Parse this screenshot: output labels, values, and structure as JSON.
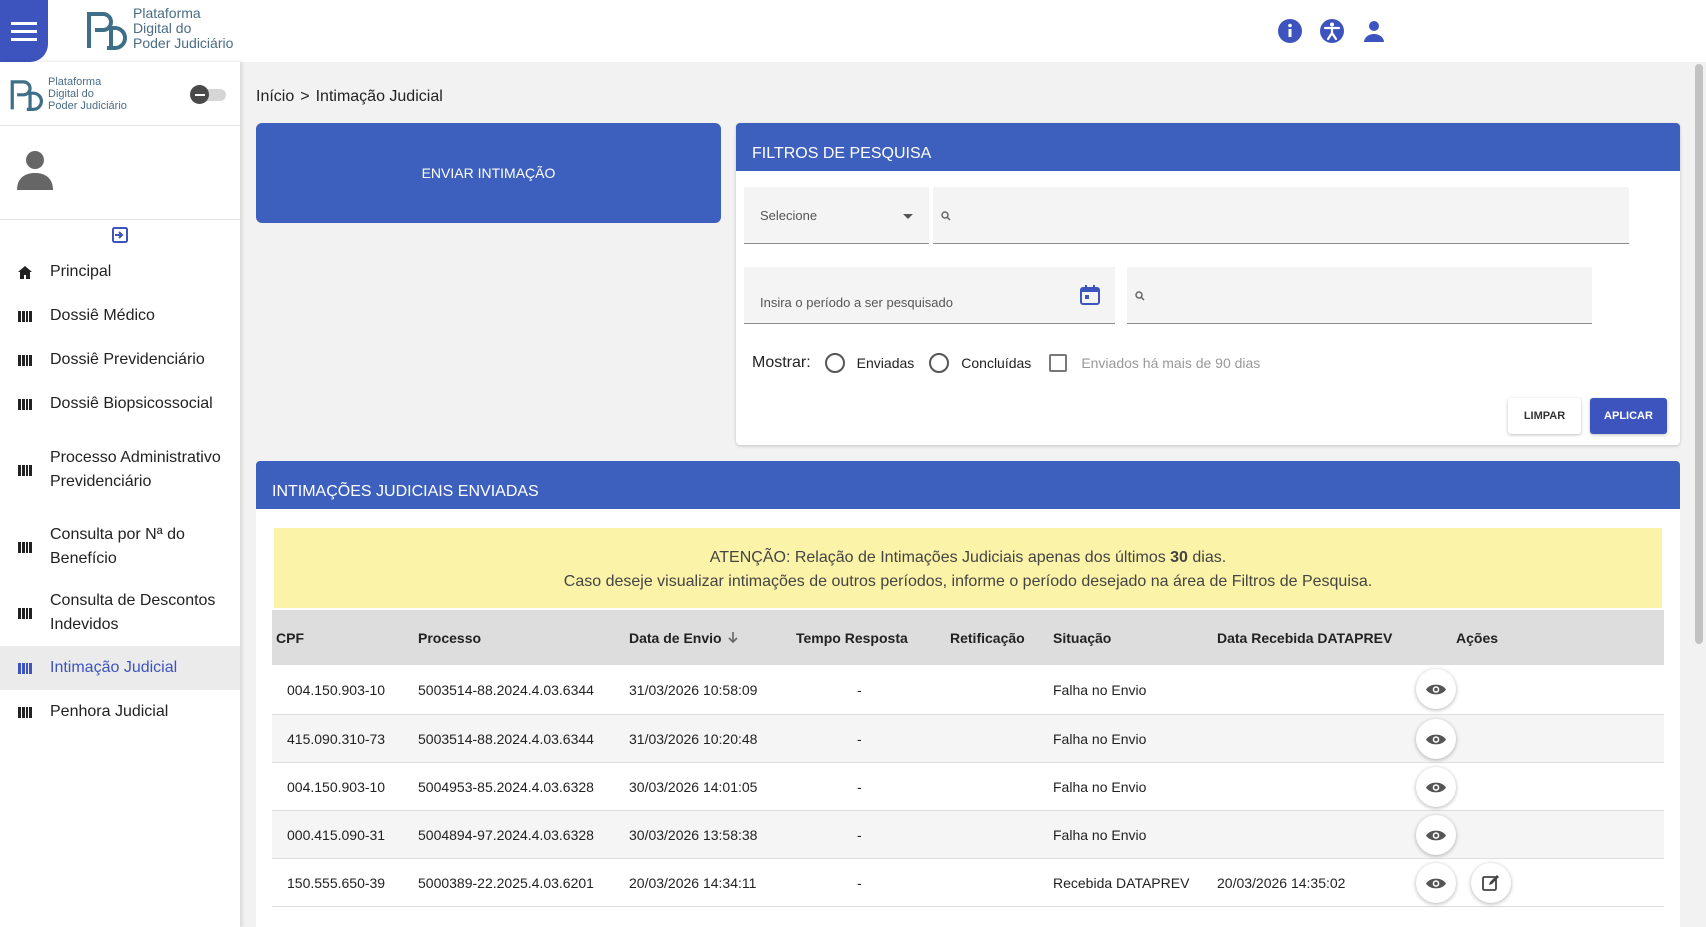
{
  "topbar": {
    "logo_lines": [
      "Plataforma",
      "Digital do",
      "Poder Judiciário"
    ],
    "icons": [
      "info-icon",
      "accessibility-icon",
      "user-icon"
    ]
  },
  "sidebar": {
    "logo_lines": [
      "Plataforma",
      "Digital do",
      "Poder Judiciário"
    ],
    "items": [
      {
        "label": "Principal",
        "icon": "home-icon"
      },
      {
        "label": "Dossiê Médico",
        "icon": "library-icon"
      },
      {
        "label": "Dossiê Previdenciário",
        "icon": "library-icon"
      },
      {
        "label": "Dossiê Biopsicossocial",
        "icon": "library-icon"
      },
      {
        "label": "Processo Administrativo Previdenciário",
        "icon": "library-icon"
      },
      {
        "label": "Consulta por Nª do Benefício",
        "icon": "library-icon"
      },
      {
        "label": "Consulta de Descontos Indevidos",
        "icon": "library-icon"
      },
      {
        "label": "Intimação Judicial",
        "icon": "library-icon",
        "active": true
      },
      {
        "label": "Penhora Judicial",
        "icon": "library-icon"
      }
    ]
  },
  "breadcrumb": {
    "home": "Início",
    "separator": ">",
    "current": "Intimação Judicial"
  },
  "send_button": "ENVIAR INTIMAÇÃO",
  "filters": {
    "title": "FILTROS DE PESQUISA",
    "select_placeholder": "Selecione",
    "period_placeholder": "Insira o período a ser pesquisado",
    "show_label": "Mostrar:",
    "opt_sent": "Enviadas",
    "opt_done": "Concluídas",
    "opt_old": "Enviados há mais de 90 dias",
    "clear": "LIMPAR",
    "apply": "APLICAR"
  },
  "results": {
    "title": "INTIMAÇÕES JUDICIAIS ENVIADAS",
    "warning_pre": "ATENÇÃO: Relação de Intimações Judiciais apenas dos últimos ",
    "warning_days": "30",
    "warning_post": " dias.",
    "warning_line2": "Caso deseje visualizar intimações de outros períodos, informe o período desejado na área de Filtros de Pesquisa.",
    "columns": [
      "CPF",
      "Processo",
      "Data de Envio",
      "Tempo Resposta",
      "Retificação",
      "Situação",
      "Data Recebida DATAPREV",
      "Ações"
    ],
    "rows": [
      {
        "cpf": "004.150.903-10",
        "processo": "5003514-88.2024.4.03.6344",
        "data_envio": "31/03/2026 10:58:09",
        "tempo": "-",
        "retificacao": "",
        "situacao": "Falha no Envio",
        "data_dataprev": "",
        "edit": false
      },
      {
        "cpf": "415.090.310-73",
        "processo": "5003514-88.2024.4.03.6344",
        "data_envio": "31/03/2026 10:20:48",
        "tempo": "-",
        "retificacao": "",
        "situacao": "Falha no Envio",
        "data_dataprev": "",
        "edit": false
      },
      {
        "cpf": "004.150.903-10",
        "processo": "5004953-85.2024.4.03.6328",
        "data_envio": "30/03/2026 14:01:05",
        "tempo": "-",
        "retificacao": "",
        "situacao": "Falha no Envio",
        "data_dataprev": "",
        "edit": false
      },
      {
        "cpf": "000.415.090-31",
        "processo": "5004894-97.2024.4.03.6328",
        "data_envio": "30/03/2026 13:58:38",
        "tempo": "-",
        "retificacao": "",
        "situacao": "Falha no Envio",
        "data_dataprev": "",
        "edit": false
      },
      {
        "cpf": "150.555.650-39",
        "processo": "5000389-22.2025.4.03.6201",
        "data_envio": "20/03/2026 14:34:11",
        "tempo": "-",
        "retificacao": "",
        "situacao": "Recebida DATAPREV",
        "data_dataprev": "20/03/2026 14:35:02",
        "edit": true
      }
    ]
  },
  "colors": {
    "primary": "#3d53be",
    "header_blue": "#3d5fbd",
    "warning_bg": "#fbf3a7"
  }
}
